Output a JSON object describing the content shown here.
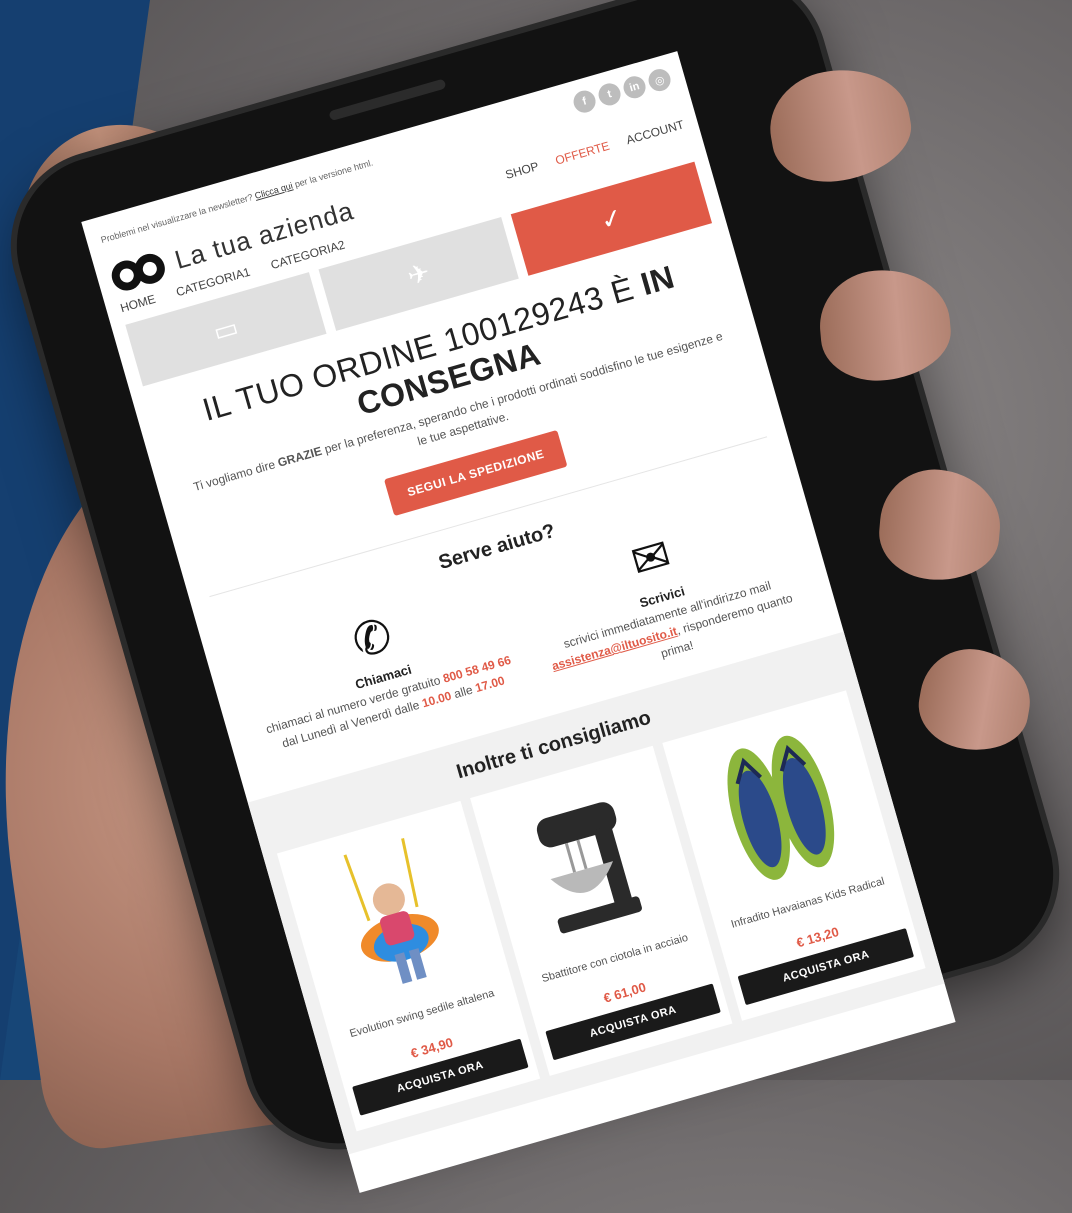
{
  "topbar": {
    "notice_prefix": "Problemi nel visualizzare la newsletter?",
    "notice_link": "Clicca qui",
    "notice_suffix": "per la versione html.",
    "socials": [
      {
        "name": "facebook-icon",
        "glyph": "f"
      },
      {
        "name": "twitter-icon",
        "glyph": "t"
      },
      {
        "name": "linkedin-icon",
        "glyph": "in"
      },
      {
        "name": "instagram-icon",
        "glyph": "◎"
      }
    ]
  },
  "header": {
    "brand": "La tua azienda",
    "menu_right": [
      "SHOP",
      "OFFERTE",
      "ACCOUNT"
    ]
  },
  "nav": [
    "HOME",
    "CATEGORIA1",
    "CATEGORIA2"
  ],
  "steps": [
    {
      "icon": "box-icon",
      "glyph": "▭",
      "active": false
    },
    {
      "icon": "plane-icon",
      "glyph": "✈",
      "active": false
    },
    {
      "icon": "check-icon",
      "glyph": "✓",
      "active": true
    }
  ],
  "order": {
    "title_prefix": "IL TUO ORDINE 100129243 È",
    "title_bold": "IN CONSEGNA",
    "sub_prefix": "Ti vogliamo dire",
    "sub_bold": "GRAZIE",
    "sub_suffix": "per la preferenza, sperando che i prodotti ordinati soddisfino le tue esigenze e le tue aspettative.",
    "button": "SEGUI LA SPEDIZIONE"
  },
  "help": {
    "title": "Serve aiuto?",
    "call": {
      "heading": "Chiamaci",
      "text1": "chiamaci al numero verde gratuito",
      "phone": "800 58 49 66",
      "text2": "dal Lunedì al Venerdì dalle",
      "from": "10.00",
      "text3": "alle",
      "to": "17.00"
    },
    "write": {
      "heading": "Scrivici",
      "text1": "scrivici immediatamente all'indirizzo mail",
      "email": "assistenza@iltuosito.it",
      "text2": ", risponderemo quanto prima!"
    }
  },
  "reco": {
    "title": "Inoltre ti consigliamo",
    "products": [
      {
        "name": "Evolution swing sedile altalena",
        "price": "€ 34,90",
        "button": "ACQUISTA ORA"
      },
      {
        "name": "Sbattitore con ciotola in acciaio",
        "price": "€ 61,00",
        "button": "ACQUISTA ORA"
      },
      {
        "name": "Infradito Havaianas Kids Radical",
        "price": "€ 13,20",
        "button": "ACQUISTA ORA"
      }
    ]
  },
  "colors": {
    "accent": "#e05a47",
    "background_band": "#153f70"
  }
}
